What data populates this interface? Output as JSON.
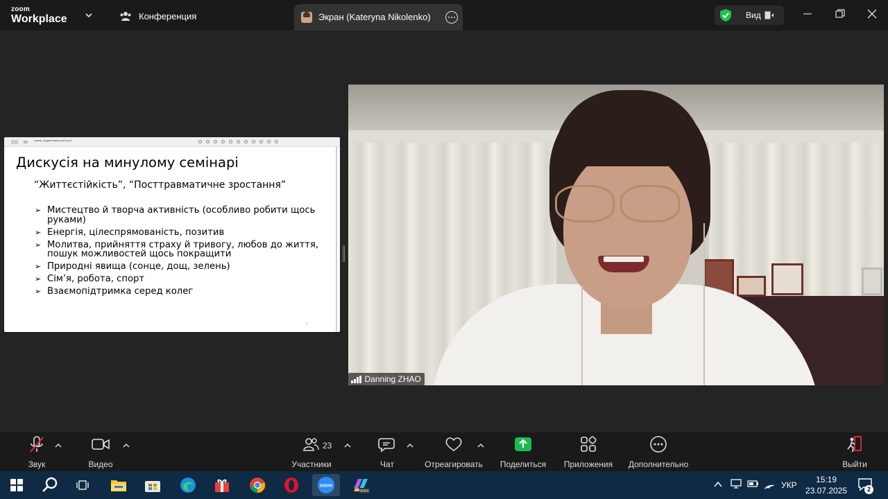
{
  "titlebar": {
    "logo_top": "zoom",
    "logo_bottom": "Workplace",
    "conference_label": "Конференция",
    "screen_tab_label": "Экран (Kateryna Nikolenko)",
    "view_label": "Вид"
  },
  "slide": {
    "file_name": "серия_1(адаптивна part ii.pdf",
    "title": "Дискусія на минулому семінарі",
    "subtitle": "“Життєстійкість”, “Посттравматичне зростання”",
    "bullets": [
      "Мистецтво й творча активність (особливо робити щось руками)",
      "Енергія, цілеспрямованість, позитив",
      "Молитва, прийняття страху й тривогу, любов до життя, пошук можливостей щось покращити",
      "Природні явища (сонце, дощ, зелень)",
      "Сім’я, робота, спорт",
      "Взаємопідтримка серед колег"
    ],
    "page_marker": "4"
  },
  "video": {
    "participant_name": "Danning ZHAO"
  },
  "toolbar": {
    "audio_label": "Звук",
    "video_label": "Видео",
    "participants_label": "Участники",
    "participants_count": "23",
    "chat_label": "Чат",
    "react_label": "Отреагировать",
    "share_label": "Поделиться",
    "apps_label": "Приложения",
    "more_label": "Дополнительно",
    "leave_label": "Выйти"
  },
  "taskbar": {
    "lang": "УКР",
    "time": "15:19",
    "date": "23.07.2025",
    "notifications": "2",
    "icons": [
      "windows-start-icon",
      "search-icon",
      "task-view-icon",
      "file-explorer-icon",
      "store-icon",
      "edge-icon",
      "gift-icon",
      "chrome-icon",
      "opera-icon",
      "zoom-icon",
      "m365-icon"
    ]
  },
  "colors": {
    "zoom_bg": "#242424",
    "bar_bg": "#1a1a1a",
    "taskbar_bg": "#0e2a44",
    "share_green": "#1db954",
    "leave_red": "#e02a3a",
    "shield_green": "#19c44a"
  }
}
